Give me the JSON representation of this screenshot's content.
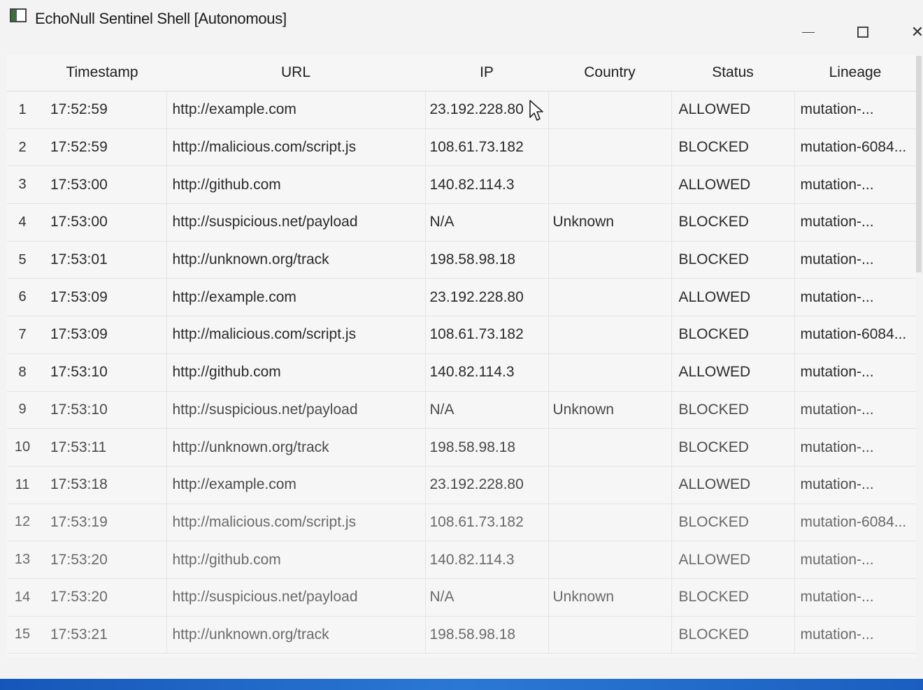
{
  "window": {
    "title": "EchoNull Sentinel Shell [Autonomous]"
  },
  "table": {
    "columns": [
      "Timestamp",
      "URL",
      "IP",
      "Country",
      "Status",
      "Lineage"
    ],
    "rows": [
      {
        "num": "1",
        "timestamp": "17:52:59",
        "url": "http://example.com",
        "ip": "23.192.228.80",
        "country": "",
        "status": "ALLOWED",
        "lineage": "mutation-..."
      },
      {
        "num": "2",
        "timestamp": "17:52:59",
        "url": "http://malicious.com/script.js",
        "ip": "108.61.73.182",
        "country": "",
        "status": "BLOCKED",
        "lineage": "mutation-6084..."
      },
      {
        "num": "3",
        "timestamp": "17:53:00",
        "url": "http://github.com",
        "ip": "140.82.114.3",
        "country": "",
        "status": "ALLOWED",
        "lineage": "mutation-..."
      },
      {
        "num": "4",
        "timestamp": "17:53:00",
        "url": "http://suspicious.net/payload",
        "ip": "N/A",
        "country": "Unknown",
        "status": "BLOCKED",
        "lineage": "mutation-..."
      },
      {
        "num": "5",
        "timestamp": "17:53:01",
        "url": "http://unknown.org/track",
        "ip": "198.58.98.18",
        "country": "",
        "status": "BLOCKED",
        "lineage": "mutation-..."
      },
      {
        "num": "6",
        "timestamp": "17:53:09",
        "url": "http://example.com",
        "ip": "23.192.228.80",
        "country": "",
        "status": "ALLOWED",
        "lineage": "mutation-..."
      },
      {
        "num": "7",
        "timestamp": "17:53:09",
        "url": "http://malicious.com/script.js",
        "ip": "108.61.73.182",
        "country": "",
        "status": "BLOCKED",
        "lineage": "mutation-6084..."
      },
      {
        "num": "8",
        "timestamp": "17:53:10",
        "url": "http://github.com",
        "ip": "140.82.114.3",
        "country": "",
        "status": "ALLOWED",
        "lineage": "mutation-..."
      },
      {
        "num": "9",
        "timestamp": "17:53:10",
        "url": "http://suspicious.net/payload",
        "ip": "N/A",
        "country": "Unknown",
        "status": "BLOCKED",
        "lineage": "mutation-..."
      },
      {
        "num": "10",
        "timestamp": "17:53:11",
        "url": "http://unknown.org/track",
        "ip": "198.58.98.18",
        "country": "",
        "status": "BLOCKED",
        "lineage": "mutation-..."
      },
      {
        "num": "11",
        "timestamp": "17:53:18",
        "url": "http://example.com",
        "ip": "23.192.228.80",
        "country": "",
        "status": "ALLOWED",
        "lineage": "mutation-..."
      },
      {
        "num": "12",
        "timestamp": "17:53:19",
        "url": "http://malicious.com/script.js",
        "ip": "108.61.73.182",
        "country": "",
        "status": "BLOCKED",
        "lineage": "mutation-6084..."
      },
      {
        "num": "13",
        "timestamp": "17:53:20",
        "url": "http://github.com",
        "ip": "140.82.114.3",
        "country": "",
        "status": "ALLOWED",
        "lineage": "mutation-..."
      },
      {
        "num": "14",
        "timestamp": "17:53:20",
        "url": "http://suspicious.net/payload",
        "ip": "N/A",
        "country": "Unknown",
        "status": "BLOCKED",
        "lineage": "mutation-..."
      },
      {
        "num": "15",
        "timestamp": "17:53:21",
        "url": "http://unknown.org/track",
        "ip": "198.58.98.18",
        "country": "",
        "status": "BLOCKED",
        "lineage": "mutation-..."
      }
    ]
  },
  "icons": {
    "app": "app-window-icon",
    "minimize": "minimize-icon",
    "maximize": "maximize-icon",
    "close": "close-icon",
    "cursor": "mouse-pointer-icon"
  }
}
